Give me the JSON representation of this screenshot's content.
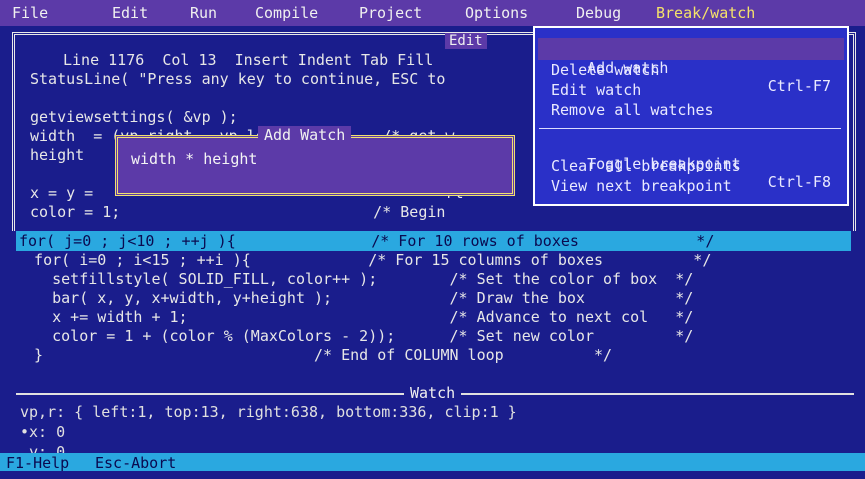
{
  "menu": [
    {
      "label": "File",
      "hot": "F"
    },
    {
      "label": "Edit",
      "hot": "E"
    },
    {
      "label": "Run",
      "hot": "R"
    },
    {
      "label": "Compile",
      "hot": "C"
    },
    {
      "label": "Project",
      "hot": "P"
    },
    {
      "label": "Options",
      "hot": "O"
    },
    {
      "label": "Debug",
      "hot": "D"
    },
    {
      "label": "Break/watch",
      "hot": "B"
    }
  ],
  "edit": {
    "title": "Edit",
    "status": "Line 1176  Col 13  Insert Indent Tab Fill",
    "lines": [
      "StatusLine( \"Press any key to continue, ESC to",
      "",
      "getviewsettings( &vp );",
      "width  = (vp.right - vp.left) / 15;    /* get w",
      "height                                         t",
      "",
      "x = y =                                       rt",
      "color = 1;                            /* Begin"
    ]
  },
  "loop": {
    "for_line": "for( j=0 ; j<10 ; ++j ){               /* For 10 rows of boxes             */",
    "lines": [
      "  for( i=0 ; i<15 ; ++i ){             /* For 15 columns of boxes          */",
      "    setfillstyle( SOLID_FILL, color++ );        /* Set the color of box  */",
      "    bar( x, y, x+width, y+height );             /* Draw the box          */",
      "    x += width + 1;                             /* Advance to next col   */",
      "    color = 1 + (color % (MaxColors - 2));      /* Set new color         */",
      "  }                              /* End of COLUMN loop          */"
    ]
  },
  "dropdown": {
    "items": [
      {
        "label": "Add watch",
        "shortcut": "Ctrl-F7"
      },
      {
        "label": "Delete watch",
        "shortcut": ""
      },
      {
        "label": "Edit watch",
        "shortcut": ""
      },
      {
        "label": "Remove all watches",
        "shortcut": ""
      },
      {
        "label": "Toggle breakpoint",
        "shortcut": "Ctrl-F8"
      },
      {
        "label": "Clear all breakpoints",
        "shortcut": ""
      },
      {
        "label": "View next breakpoint",
        "shortcut": ""
      }
    ]
  },
  "add_watch": {
    "title": "Add Watch",
    "value": "width * height"
  },
  "watch": {
    "title": "Watch",
    "lines": [
      "vp,r: { left:1, top:13, right:638, bottom:336, clip:1 }",
      "•x: 0",
      " y: 0"
    ]
  },
  "footer": {
    "help": "F1-Help",
    "abort": "Esc-Abort"
  }
}
